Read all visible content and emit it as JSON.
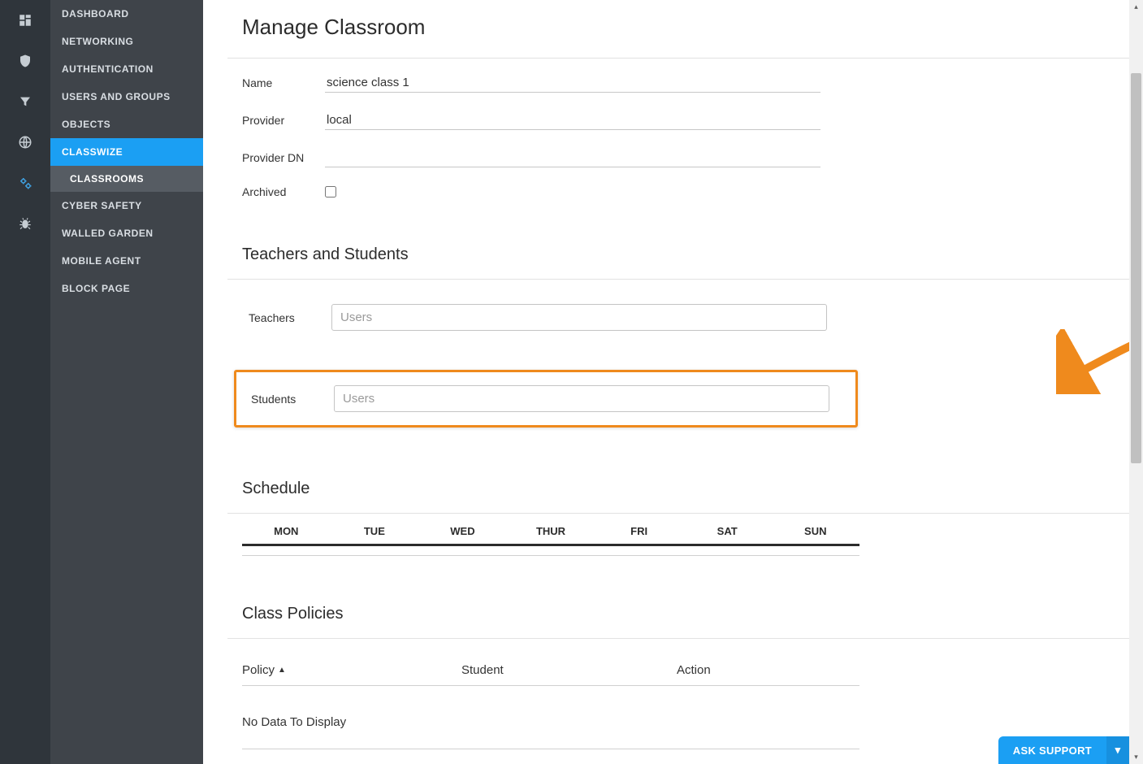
{
  "rail_icons": [
    "dashboard-icon",
    "shield-icon",
    "filter-icon",
    "globe-icon",
    "gears-icon",
    "bug-icon"
  ],
  "sidebar": {
    "items": [
      {
        "label": "DASHBOARD"
      },
      {
        "label": "NETWORKING"
      },
      {
        "label": "AUTHENTICATION"
      },
      {
        "label": "USERS AND GROUPS"
      },
      {
        "label": "OBJECTS"
      },
      {
        "label": "CLASSWIZE"
      },
      {
        "label": "CYBER SAFETY"
      },
      {
        "label": "WALLED GARDEN"
      },
      {
        "label": "MOBILE AGENT"
      },
      {
        "label": "BLOCK PAGE"
      }
    ],
    "sub": {
      "classrooms": "CLASSROOMS"
    }
  },
  "page": {
    "title": "Manage Classroom",
    "fields": {
      "name_label": "Name",
      "name_value": "science class 1",
      "provider_label": "Provider",
      "provider_value": "local",
      "providerdn_label": "Provider DN",
      "providerdn_value": "",
      "archived_label": "Archived"
    },
    "teachers_section": "Teachers and Students",
    "teachers_label": "Teachers",
    "teachers_placeholder": "Users",
    "students_label": "Students",
    "students_placeholder": "Users",
    "schedule_section": "Schedule",
    "schedule_days": [
      "MON",
      "TUE",
      "WED",
      "THUR",
      "FRI",
      "SAT",
      "SUN"
    ],
    "policies_section": "Class Policies",
    "policies_cols": {
      "policy": "Policy",
      "student": "Student",
      "action": "Action"
    },
    "policies_empty": "No Data To Display"
  },
  "support_button": "ASK SUPPORT"
}
